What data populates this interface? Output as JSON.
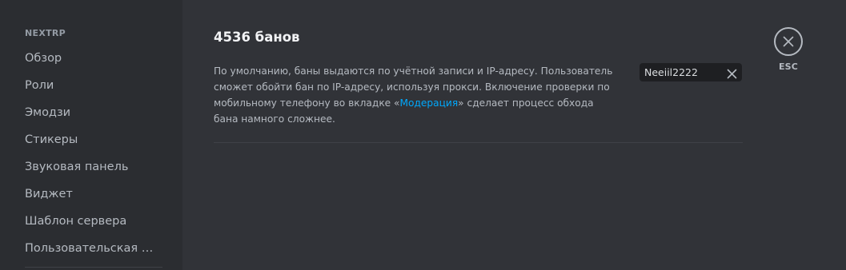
{
  "sidebar": {
    "server_name": "NEXTRP",
    "items": [
      {
        "label": "Обзор"
      },
      {
        "label": "Роли"
      },
      {
        "label": "Эмодзи"
      },
      {
        "label": "Стикеры"
      },
      {
        "label": "Звуковая панель"
      },
      {
        "label": "Виджет"
      },
      {
        "label": "Шаблон сервера"
      },
      {
        "label": "Пользовательская сс..."
      }
    ]
  },
  "main": {
    "title": "4536 банов",
    "description_before": "По умолчанию, баны выдаются по учётной записи и IP-адресу. Пользователь сможет обойти бан по IP-адресу, используя прокси. Включение проверки по мобильному телефону во вкладке «",
    "description_link": "Модерация",
    "description_after": "» сделает процесс обхода бана намного сложнее.",
    "search": {
      "value": "Neeiil2222",
      "clear_icon": "close-icon"
    }
  },
  "close": {
    "icon": "close-icon",
    "label": "ESC"
  },
  "colors": {
    "sidebar_bg": "#2b2d31",
    "main_bg": "#313338",
    "link": "#00a8fc",
    "input_bg": "#1e1f22"
  }
}
